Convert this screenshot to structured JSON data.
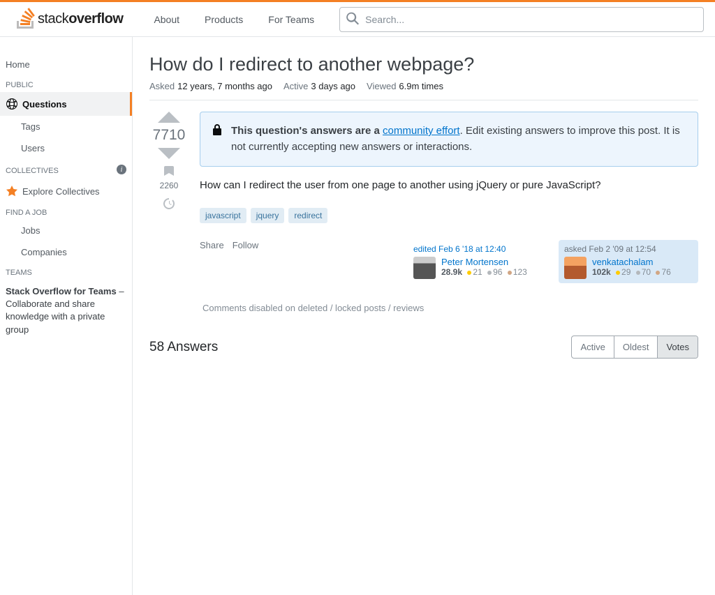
{
  "brand": {
    "part1": "stack",
    "part2": "overflow"
  },
  "topnav": {
    "about": "About",
    "products": "Products",
    "teams": "For Teams"
  },
  "search": {
    "placeholder": "Search..."
  },
  "sidebar": {
    "home": "Home",
    "public_label": "PUBLIC",
    "questions": "Questions",
    "tags": "Tags",
    "users": "Users",
    "collectives_label": "COLLECTIVES",
    "explore": "Explore Collectives",
    "findjob_label": "FIND A JOB",
    "jobs": "Jobs",
    "companies": "Companies",
    "teams_label": "TEAMS",
    "teams_box_bold": "Stack Overflow for Teams",
    "teams_box_rest": " – Collaborate and share knowledge with a private group"
  },
  "question": {
    "title": "How do I redirect to another webpage?",
    "asked_label": "Asked",
    "asked_val": "12 years, 7 months ago",
    "active_label": "Active",
    "active_val": "3 days ago",
    "viewed_label": "Viewed",
    "viewed_val": "6.9m times",
    "score": "7710",
    "bookmarks": "2260",
    "notice_bold": "This question's answers are a ",
    "notice_link": "community effort",
    "notice_rest": ". Edit existing answers to improve this post. It is not currently accepting new answers or interactions.",
    "body": "How can I redirect the user from one page to another using jQuery or pure JavaScript?",
    "tags": [
      "javascript",
      "jquery",
      "redirect"
    ],
    "share": "Share",
    "follow": "Follow",
    "comments_disabled": "Comments disabled on deleted / locked posts / reviews"
  },
  "editor": {
    "action": "edited ",
    "time": "Feb 6 '18 at 12:40",
    "name": "Peter Mortensen",
    "rep": "28.9k",
    "gold": "21",
    "silver": "96",
    "bronze": "123"
  },
  "asker": {
    "action": "asked ",
    "time": "Feb 2 '09 at 12:54",
    "name": "venkatachalam",
    "rep": "102k",
    "gold": "29",
    "silver": "70",
    "bronze": "76"
  },
  "answers": {
    "count_label": "58 Answers",
    "sort_active": "Active",
    "sort_oldest": "Oldest",
    "sort_votes": "Votes"
  }
}
